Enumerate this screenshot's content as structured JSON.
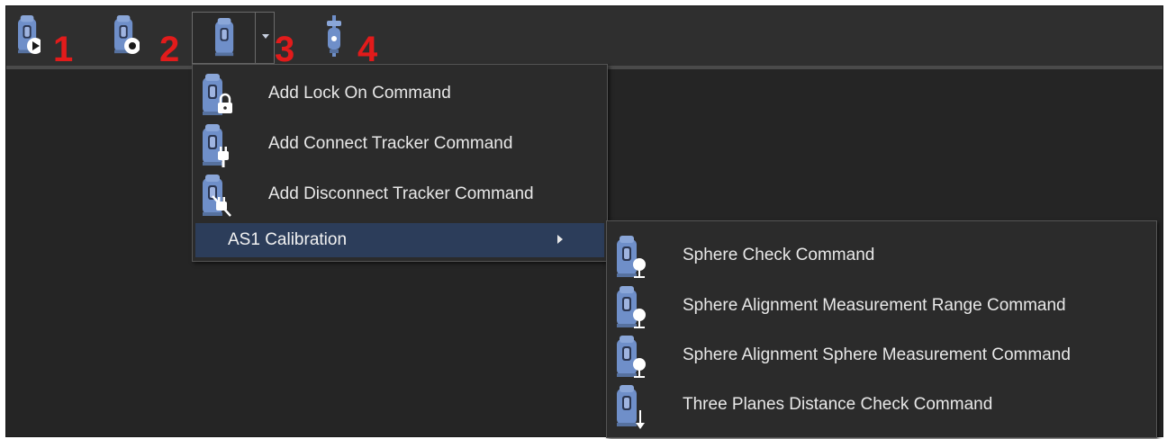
{
  "toolbar": {
    "buttons": [
      {
        "number": "1",
        "icon": "tracker-run-icon"
      },
      {
        "number": "2",
        "icon": "tracker-stop-icon"
      },
      {
        "number": "3",
        "icon": "tracker-dropdown-icon"
      },
      {
        "number": "4",
        "icon": "probe-icon"
      }
    ]
  },
  "menu": {
    "items": [
      {
        "label": "Add Lock On Command",
        "icon": "tracker-lock-icon"
      },
      {
        "label": "Add Connect Tracker Command",
        "icon": "tracker-connect-icon"
      },
      {
        "label": "Add Disconnect Tracker Command",
        "icon": "tracker-disconnect-icon"
      },
      {
        "label": "AS1 Calibration",
        "icon": "submenu-arrow-icon"
      }
    ]
  },
  "submenu": {
    "items": [
      {
        "label": "Sphere Check Command",
        "icon": "tracker-sphere-icon"
      },
      {
        "label": "Sphere Alignment Measurement Range Command",
        "icon": "tracker-sphere-icon"
      },
      {
        "label": "Sphere Alignment Sphere Measurement Command",
        "icon": "tracker-sphere-icon"
      },
      {
        "label": "Three Planes Distance Check Command",
        "icon": "tracker-arrow-down-icon"
      }
    ]
  },
  "colors": {
    "background": "#252525",
    "toolbar": "#2f2f2f",
    "menu": "#2b2b2b",
    "highlight": "#2c3d5a",
    "icon_blue": "#6f8fc9",
    "annotation_red": "#e21b1b"
  }
}
